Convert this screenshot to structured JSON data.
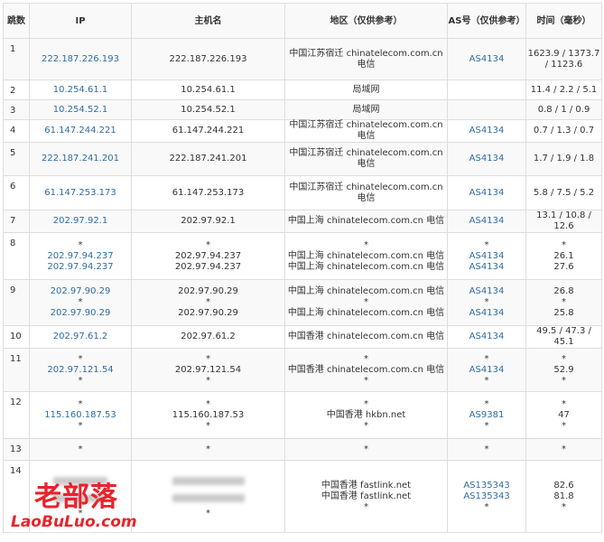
{
  "headers": {
    "hop": "跳数",
    "ip": "IP",
    "host": "主机名",
    "region": "地区（仅供参考）",
    "asn": "AS号（仅供参考）",
    "time": "时间（毫秒）"
  },
  "rows": [
    {
      "hop": "1",
      "ip": [
        "222.187.226.193"
      ],
      "host": [
        "222.187.226.193"
      ],
      "region": [
        "中国江苏宿迁 chinatelecom.com.cn 电信"
      ],
      "asn": [
        "AS4134"
      ],
      "time": [
        "1623.9 / 1373.7 / 1123.6"
      ]
    },
    {
      "hop": "2",
      "ip": [
        "10.254.61.1"
      ],
      "host": [
        "10.254.61.1"
      ],
      "region": [
        "局域网"
      ],
      "asn": [
        ""
      ],
      "time": [
        "11.4 / 2.2 / 5.1"
      ]
    },
    {
      "hop": "3",
      "ip": [
        "10.254.52.1"
      ],
      "host": [
        "10.254.52.1"
      ],
      "region": [
        "局域网"
      ],
      "asn": [
        ""
      ],
      "time": [
        "0.8 / 1 / 0.9"
      ]
    },
    {
      "hop": "4",
      "ip": [
        "61.147.244.221"
      ],
      "host": [
        "61.147.244.221"
      ],
      "region": [
        "中国江苏宿迁 chinatelecom.com.cn 电信"
      ],
      "asn": [
        "AS4134"
      ],
      "time": [
        "0.7 / 1.3 / 0.7"
      ]
    },
    {
      "hop": "5",
      "ip": [
        "222.187.241.201"
      ],
      "host": [
        "222.187.241.201"
      ],
      "region": [
        "中国江苏宿迁 chinatelecom.com.cn 电信"
      ],
      "asn": [
        "AS4134"
      ],
      "time": [
        "1.7 / 1.9 / 1.8"
      ]
    },
    {
      "hop": "6",
      "ip": [
        "61.147.253.173"
      ],
      "host": [
        "61.147.253.173"
      ],
      "region": [
        "中国江苏宿迁 chinatelecom.com.cn 电信"
      ],
      "asn": [
        "AS4134"
      ],
      "time": [
        "5.8 / 7.5 / 5.2"
      ]
    },
    {
      "hop": "7",
      "ip": [
        "202.97.92.1"
      ],
      "host": [
        "202.97.92.1"
      ],
      "region": [
        "中国上海 chinatelecom.com.cn 电信"
      ],
      "asn": [
        "AS4134"
      ],
      "time": [
        "13.1 / 10.8 / 12.6"
      ]
    },
    {
      "hop": "8",
      "ip": [
        "*",
        "202.97.94.237",
        "202.97.94.237"
      ],
      "host": [
        "*",
        "202.97.94.237",
        "202.97.94.237"
      ],
      "region": [
        "*",
        "中国上海 chinatelecom.com.cn 电信",
        "中国上海 chinatelecom.com.cn 电信"
      ],
      "asn": [
        "*",
        "AS4134",
        "AS4134"
      ],
      "time": [
        "*",
        "26.1",
        "27.6"
      ]
    },
    {
      "hop": "9",
      "ip": [
        "202.97.90.29",
        "*",
        "202.97.90.29"
      ],
      "host": [
        "202.97.90.29",
        "*",
        "202.97.90.29"
      ],
      "region": [
        "中国上海 chinatelecom.com.cn 电信",
        "*",
        "中国上海 chinatelecom.com.cn 电信"
      ],
      "asn": [
        "AS4134",
        "*",
        "AS4134"
      ],
      "time": [
        "26.8",
        "*",
        "25.8"
      ]
    },
    {
      "hop": "10",
      "ip": [
        "202.97.61.2"
      ],
      "host": [
        "202.97.61.2"
      ],
      "region": [
        "中国香港 chinatelecom.com.cn 电信"
      ],
      "asn": [
        "AS4134"
      ],
      "time": [
        "49.5 / 47.3 / 45.1"
      ]
    },
    {
      "hop": "11",
      "ip": [
        "*",
        "202.97.121.54",
        "*"
      ],
      "host": [
        "*",
        "202.97.121.54",
        "*"
      ],
      "region": [
        "*",
        "中国香港 chinatelecom.com.cn 电信",
        "*"
      ],
      "asn": [
        "*",
        "AS4134",
        "*"
      ],
      "time": [
        "*",
        "52.9",
        "*"
      ]
    },
    {
      "hop": "12",
      "ip": [
        "*",
        "115.160.187.53",
        "*"
      ],
      "host": [
        "*",
        "115.160.187.53",
        "*"
      ],
      "region": [
        "*",
        "中国香港 hkbn.net",
        "*"
      ],
      "asn": [
        "*",
        "AS9381",
        "*"
      ],
      "time": [
        "*",
        "47",
        "*"
      ]
    },
    {
      "hop": "13",
      "ip": [
        "*"
      ],
      "host": [
        "*"
      ],
      "region": [
        "*"
      ],
      "asn": [
        "*"
      ],
      "time": [
        "*"
      ]
    },
    {
      "hop": "14",
      "ip": [
        "",
        "",
        "*"
      ],
      "host": [
        "",
        "",
        "*"
      ],
      "region": [
        "中国香港 fastlink.net",
        "中国香港 fastlink.net",
        "*"
      ],
      "asn": [
        "AS135343",
        "AS135343",
        "*"
      ],
      "time": [
        "82.6",
        "81.8",
        "*"
      ]
    }
  ],
  "watermark": {
    "top": "老部落",
    "bottom": "LaoBuLuo.com"
  },
  "colors": {
    "link": "#2e6da4",
    "border": "#dddddd",
    "stripe": "#f9f9f9",
    "watermark": "#e8232b"
  }
}
